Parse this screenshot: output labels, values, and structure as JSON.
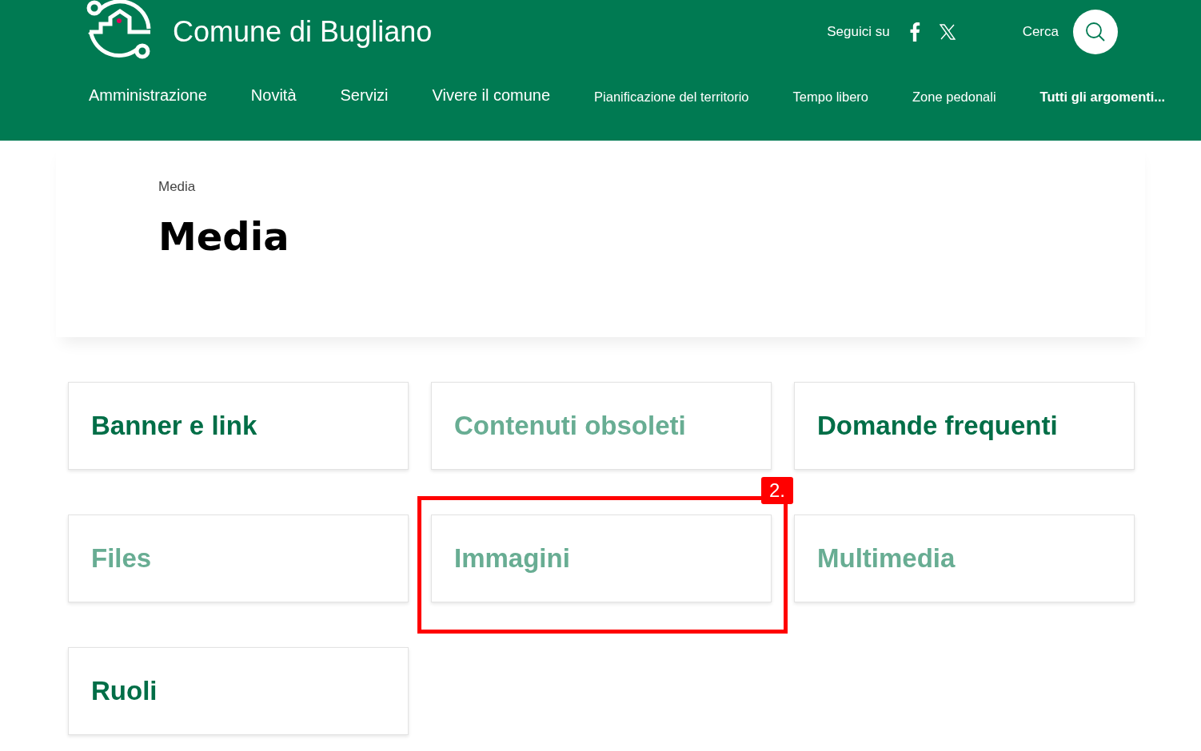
{
  "header": {
    "site_name": "Comune di Bugliano",
    "follow_label": "Seguici su",
    "search_label": "Cerca"
  },
  "nav": [
    {
      "label": "Amministrazione",
      "kind": "primary"
    },
    {
      "label": "Novità",
      "kind": "primary"
    },
    {
      "label": "Servizi",
      "kind": "primary"
    },
    {
      "label": "Vivere il comune",
      "kind": "primary"
    },
    {
      "label": "Pianificazione del territorio",
      "kind": "secondary"
    },
    {
      "label": "Tempo libero",
      "kind": "secondary"
    },
    {
      "label": "Zone pedonali",
      "kind": "secondary"
    },
    {
      "label": "Tutti gli argomenti...",
      "kind": "all"
    }
  ],
  "breadcrumb": "Media",
  "title": "Media",
  "cards": [
    {
      "label": "Banner e link",
      "muted": false,
      "annotated": false
    },
    {
      "label": "Contenuti obsoleti",
      "muted": true,
      "annotated": false
    },
    {
      "label": "Domande frequenti",
      "muted": false,
      "annotated": false
    },
    {
      "label": "Files",
      "muted": true,
      "annotated": false
    },
    {
      "label": "Immagini",
      "muted": true,
      "annotated": true
    },
    {
      "label": "Multimedia",
      "muted": true,
      "annotated": false
    },
    {
      "label": "Ruoli",
      "muted": false,
      "annotated": false
    }
  ],
  "annotation": {
    "label": "2."
  }
}
